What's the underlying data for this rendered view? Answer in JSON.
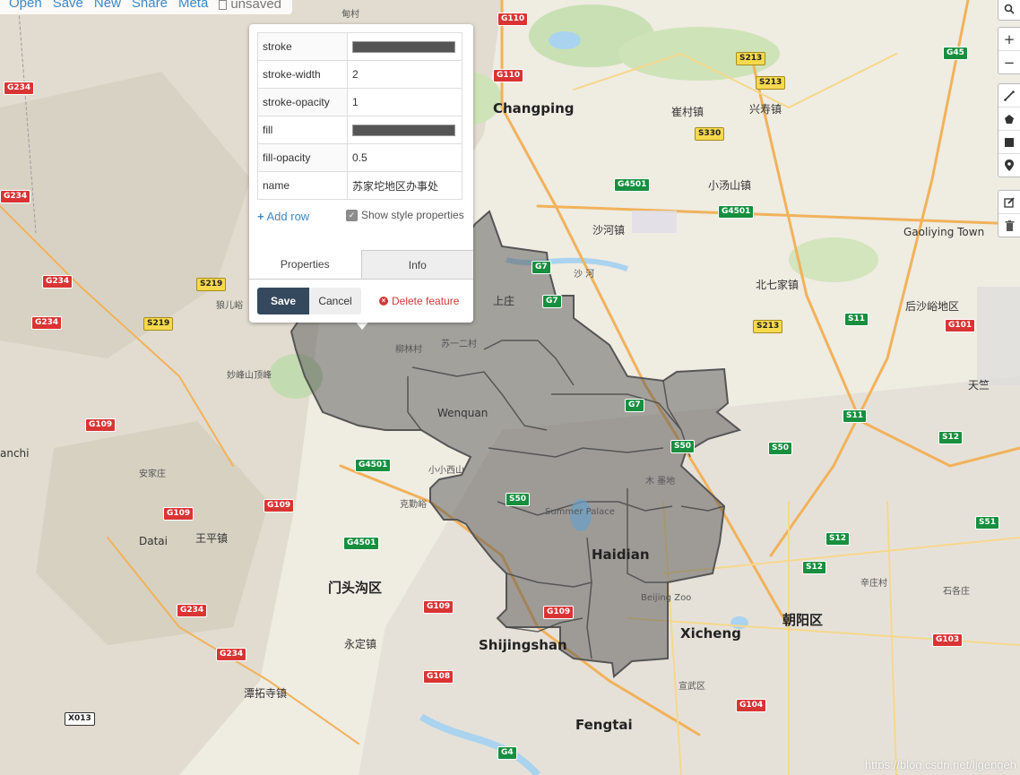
{
  "menu": {
    "open": "Open",
    "save": "Save",
    "new": "New",
    "share": "Share",
    "meta": "Meta",
    "status": "unsaved"
  },
  "controls": {
    "zoom_in": "+",
    "zoom_out": "−"
  },
  "popup": {
    "properties": [
      {
        "key": "stroke",
        "value": "#555555",
        "kind": "color"
      },
      {
        "key": "stroke-width",
        "value": "2",
        "kind": "text"
      },
      {
        "key": "stroke-opacity",
        "value": "1",
        "kind": "text"
      },
      {
        "key": "fill",
        "value": "#555555",
        "kind": "color"
      },
      {
        "key": "fill-opacity",
        "value": "0.5",
        "kind": "text"
      },
      {
        "key": "name",
        "value": "苏家坨地区办事处",
        "kind": "text"
      }
    ],
    "add_row_icon": "+",
    "add_row_label": "Add row",
    "show_style_label": "Show style properties",
    "tab_properties": "Properties",
    "tab_info": "Info",
    "save_button": "Save",
    "cancel_button": "Cancel",
    "delete_button": "Delete feature"
  },
  "map_labels": {
    "changping": "Changping",
    "cuicun": "崔村镇",
    "xingshou": "兴寿镇",
    "xiaotangshan": "小汤山镇",
    "shahe_town": "沙河镇",
    "shahe": "沙 河",
    "gaoliying": "Gaoliying Town",
    "beiqijia": "北七家镇",
    "houshayu": "后沙峪地区",
    "tianzhu": "天竺",
    "shangzhuang": "上庄",
    "su_er": "苏一二村",
    "liulin": "柳林村",
    "wenquan": "Wenquan",
    "xiao_xiao": "小小西山",
    "keqin": "克勤峪",
    "summer_palace": "Summer Palace",
    "haidian": "Haidian",
    "beijing_zoo": "Beijing Zoo",
    "xicheng": "Xicheng",
    "chaoyang": "朝阳区",
    "fengtai": "Fengtai",
    "shijingshan": "Shijingshan",
    "mentougou": "门头沟区",
    "yongding": "永定镇",
    "tanzhe": "潭拓寺镇",
    "wangping": "王平镇",
    "datai": "Datai",
    "anjiazhuang": "安家庄",
    "anchi": "anchi",
    "miaofeng": "妙峰山顶峰",
    "langer": "狼儿峪",
    "xuanwu": "宣武区",
    "jiangtai": "辛庄村",
    "shigezhuang": "石各庄",
    "dianjiang": "甸村",
    "muxidi": "木 墨地"
  },
  "roads": {
    "g110": "G110",
    "g45": "G45",
    "s213": "S213",
    "s330": "S330",
    "g234": "G234",
    "g4501": "G4501",
    "s219": "S219",
    "g7": "G7",
    "s11": "S11",
    "g101": "G101",
    "s50": "S50",
    "s12": "S12",
    "g109": "G109",
    "s51": "S51",
    "g103": "G103",
    "g108": "G108",
    "g104": "G104",
    "x013": "X013",
    "g4": "G4"
  },
  "watermark": "https://blog.csdn.net/ljgengeh",
  "colors": {
    "accent": "#3c88c7",
    "save_button": "#34495e",
    "delete": "#d43838",
    "polygon_fill": "#555555"
  }
}
